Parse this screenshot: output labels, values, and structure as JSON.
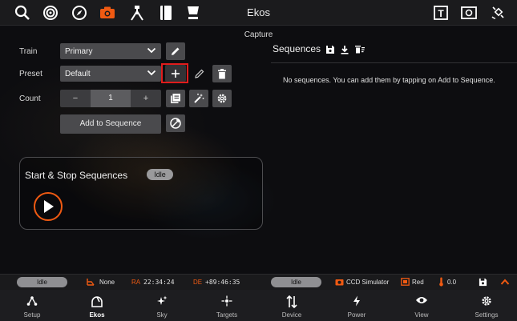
{
  "app": {
    "title": "Ekos",
    "module_title": "Capture",
    "accent_color": "#f05a12",
    "toolbar_icons": [
      "search-icon",
      "target-icon",
      "compass-icon",
      "camera-icon",
      "tripod-icon",
      "book-icon",
      "focus-icon",
      "text-frame-icon",
      "photo-frame-icon",
      "satellite-icon"
    ]
  },
  "form": {
    "train_label": "Train",
    "train_value": "Primary",
    "preset_label": "Preset",
    "preset_value": "Default",
    "count_label": "Count",
    "count_minus": "−",
    "count_value": "1",
    "count_plus": "+",
    "add_to_sequence": "Add to Sequence"
  },
  "sequence_control": {
    "title": "Start & Stop Sequences",
    "status": "Idle"
  },
  "sequences": {
    "title": "Sequences",
    "empty_text": "No sequences. You can add them by tapping on Add to Sequence."
  },
  "statusbar": {
    "mount_status": "Idle",
    "park_state": "None",
    "ra_label": "RA",
    "ra_value": "22:34:24",
    "de_label": "DE",
    "de_value": "+89:46:35",
    "camera_status": "Idle",
    "camera_name": "CCD Simulator",
    "filter_name": "Red",
    "temperature": "0.0"
  },
  "bottom_nav": [
    {
      "label": "Setup",
      "icon": "network-icon",
      "active": false
    },
    {
      "label": "Ekos",
      "icon": "observatory-icon",
      "active": true
    },
    {
      "label": "Sky",
      "icon": "sparkle-icon",
      "active": false
    },
    {
      "label": "Targets",
      "icon": "star-target-icon",
      "active": false
    },
    {
      "label": "Device",
      "icon": "updown-arrows-icon",
      "active": false
    },
    {
      "label": "Power",
      "icon": "bolt-icon",
      "active": false
    },
    {
      "label": "View",
      "icon": "eye-icon",
      "active": false
    },
    {
      "label": "Settings",
      "icon": "gear-icon",
      "active": false
    }
  ]
}
